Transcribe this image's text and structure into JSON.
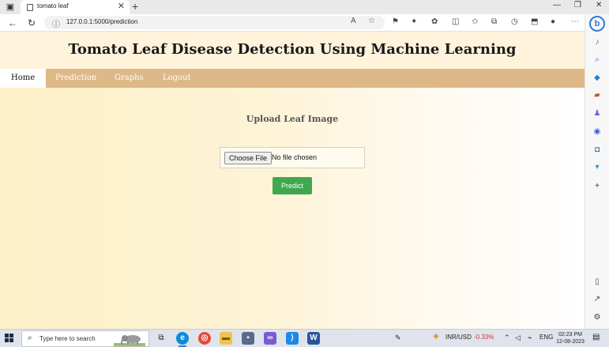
{
  "browser": {
    "tab_title": "tomato leaf",
    "tab_close": "✕",
    "new_tab": "+",
    "url": "127.0.0.1:5000/prediction",
    "window_controls": {
      "minimize": "—",
      "maximize": "❐",
      "close": "✕"
    }
  },
  "site": {
    "title": "Tomato Leaf Disease Detection Using Machine Learning",
    "nav": [
      {
        "label": "Home",
        "active": true
      },
      {
        "label": "Prediction",
        "active": false
      },
      {
        "label": "Graphs",
        "active": false
      },
      {
        "label": "Logout",
        "active": false
      }
    ]
  },
  "upload": {
    "heading": "Upload Leaf Image",
    "choose_file_label": "Choose File",
    "no_file_text": "No file chosen",
    "predict_label": "Predict"
  },
  "taskbar": {
    "search_placeholder": "Type here to search",
    "stock_label": "INR/USD",
    "stock_change": "-0.33%",
    "language": "ENG",
    "time": "02:23 PM",
    "date": "12-08-2023"
  },
  "colors": {
    "nav_bg": "#deb887",
    "predict_bg": "#3ea84f",
    "stock_negative": "#d13438"
  }
}
